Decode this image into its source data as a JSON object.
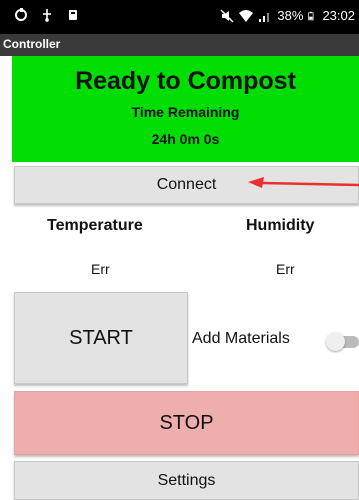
{
  "status_bar": {
    "battery": "38%",
    "time": "23:02",
    "left_icons": [
      "sync-icon",
      "usb-icon",
      "notification-icon"
    ],
    "right_icons": [
      "mute-icon",
      "wifi-icon",
      "signal-icon",
      "battery-icon"
    ]
  },
  "app": {
    "title": "Controller"
  },
  "banner": {
    "status": "Ready to Compost",
    "time_label": "Time Remaining",
    "time_value": "24h 0m 0s",
    "color": "#00dd00"
  },
  "controls": {
    "connect_label": "Connect",
    "start_label": "START",
    "stop_label": "STOP",
    "settings_label": "Settings",
    "stop_color": "#eeaeae"
  },
  "readings": {
    "temperature_label": "Temperature",
    "humidity_label": "Humidity",
    "temperature_value": "Err",
    "humidity_value": "Err"
  },
  "add_materials": {
    "label": "Add Materials",
    "enabled": false
  },
  "annotation": {
    "arrow_color": "#e8312f"
  }
}
